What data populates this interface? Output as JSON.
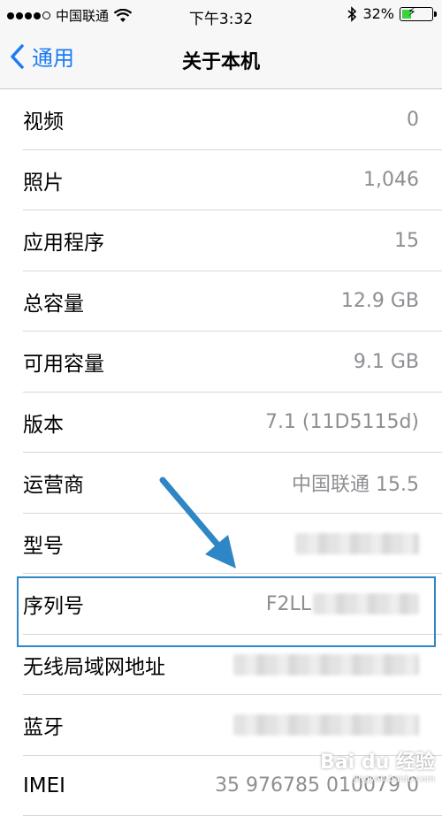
{
  "status": {
    "carrier": "中国联通",
    "time": "下午3:32",
    "battery": "32%",
    "battery_level": 0.32
  },
  "nav": {
    "back_label": "通用",
    "title": "关于本机"
  },
  "rows": [
    {
      "label": "视频",
      "value": "0"
    },
    {
      "label": "照片",
      "value": "1,046"
    },
    {
      "label": "应用程序",
      "value": "15"
    },
    {
      "label": "总容量",
      "value": "12.9 GB"
    },
    {
      "label": "可用容量",
      "value": "9.1 GB"
    },
    {
      "label": "版本",
      "value": "7.1 (11D5115d)"
    },
    {
      "label": "运营商",
      "value": "中国联通 15.5"
    },
    {
      "label": "型号",
      "value": ""
    },
    {
      "label": "序列号",
      "value": "F2LL"
    },
    {
      "label": "无线局域网地址",
      "value": ""
    },
    {
      "label": "蓝牙",
      "value": ""
    },
    {
      "label": "IMEI",
      "value": "35 976785 010079 0"
    }
  ],
  "watermark": {
    "brand": "Bai du 经验",
    "url": "jingyan.baidu.com"
  },
  "colors": {
    "accent": "#1a7cf5",
    "highlight": "#2f86c6",
    "battery": "#3bd43a"
  }
}
